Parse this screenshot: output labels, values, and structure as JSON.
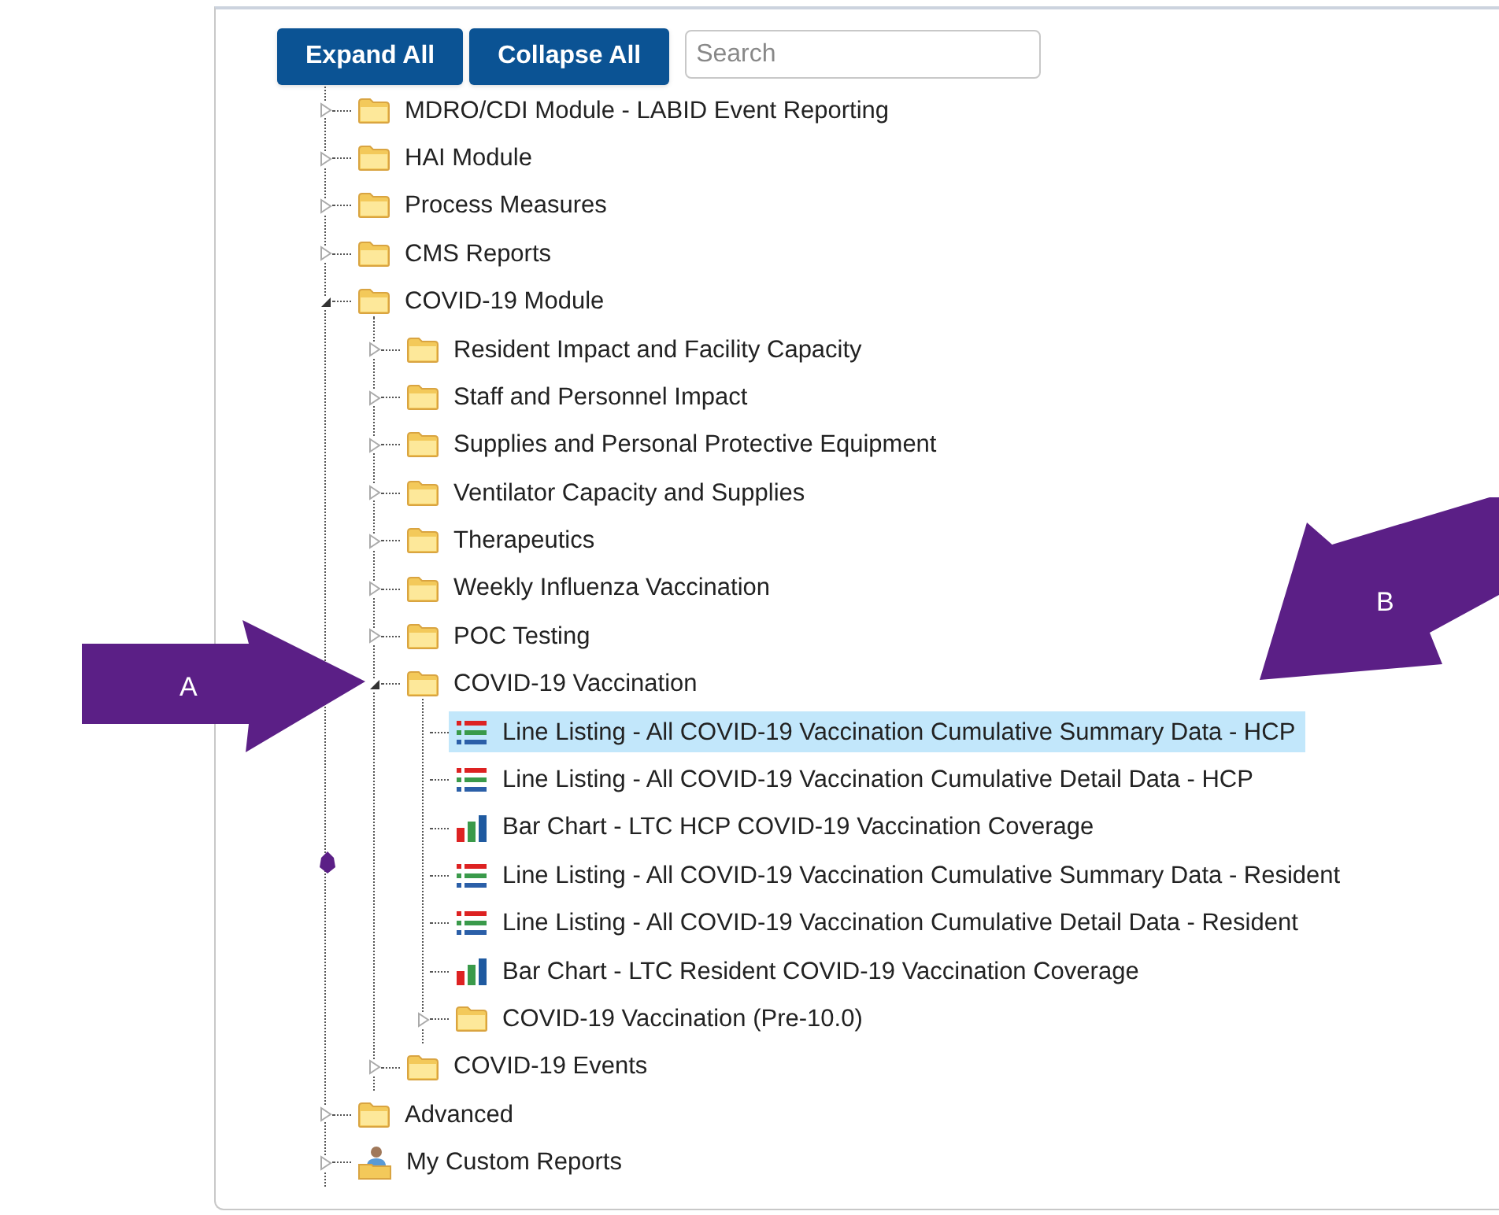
{
  "toolbar": {
    "buttons": [
      "Expand All",
      "Collapse All"
    ],
    "search": {
      "placeholder": "Search"
    }
  },
  "tree": [
    {
      "kind": "folder",
      "label": "MDRO/CDI Module - LABID Event Reporting",
      "expanded": false,
      "selected": false
    },
    {
      "kind": "folder",
      "label": "HAI Module",
      "expanded": false,
      "selected": false
    },
    {
      "kind": "folder",
      "label": "Process Measures",
      "expanded": false,
      "selected": false
    },
    {
      "kind": "folder",
      "label": "CMS Reports",
      "expanded": false,
      "selected": false
    },
    {
      "kind": "folder",
      "label": "COVID-19 Module",
      "expanded": true,
      "selected": false,
      "children": [
        {
          "kind": "folder",
          "label": "Resident Impact and Facility Capacity",
          "expanded": false,
          "selected": false
        },
        {
          "kind": "folder",
          "label": "Staff and Personnel Impact",
          "expanded": false,
          "selected": false
        },
        {
          "kind": "folder",
          "label": "Supplies and Personal Protective Equipment",
          "expanded": false,
          "selected": false
        },
        {
          "kind": "folder",
          "label": "Ventilator Capacity and Supplies",
          "expanded": false,
          "selected": false
        },
        {
          "kind": "folder",
          "label": "Therapeutics",
          "expanded": false,
          "selected": false
        },
        {
          "kind": "folder",
          "label": "Weekly Influenza Vaccination",
          "expanded": false,
          "selected": false
        },
        {
          "kind": "folder",
          "label": "POC Testing",
          "expanded": false,
          "selected": false
        },
        {
          "kind": "folder",
          "label": "COVID-19 Vaccination",
          "expanded": true,
          "selected": false,
          "children": [
            {
              "kind": "listing",
              "label": "Line Listing - All COVID-19 Vaccination Cumulative Summary Data - HCP",
              "selected": true
            },
            {
              "kind": "listing",
              "label": "Line Listing - All COVID-19 Vaccination Cumulative Detail Data - HCP",
              "selected": false
            },
            {
              "kind": "chart",
              "label": "Bar Chart - LTC HCP COVID-19 Vaccination Coverage",
              "selected": false
            },
            {
              "kind": "listing",
              "label": "Line Listing - All COVID-19 Vaccination Cumulative Summary Data - Resident",
              "selected": false
            },
            {
              "kind": "listing",
              "label": "Line Listing - All COVID-19 Vaccination Cumulative Detail Data - Resident",
              "selected": false
            },
            {
              "kind": "chart",
              "label": "Bar Chart - LTC Resident COVID-19 Vaccination Coverage",
              "selected": false
            },
            {
              "kind": "folder",
              "label": "COVID-19 Vaccination (Pre-10.0)",
              "expanded": false,
              "selected": false
            }
          ]
        },
        {
          "kind": "folder",
          "label": "COVID-19 Events",
          "expanded": false,
          "selected": false
        }
      ]
    },
    {
      "kind": "folder",
      "label": "Advanced",
      "expanded": false,
      "selected": false
    },
    {
      "kind": "custom",
      "label": "My Custom Reports",
      "expanded": false,
      "selected": false
    }
  ],
  "annotations": [
    {
      "label": "A"
    },
    {
      "label": "B"
    }
  ]
}
